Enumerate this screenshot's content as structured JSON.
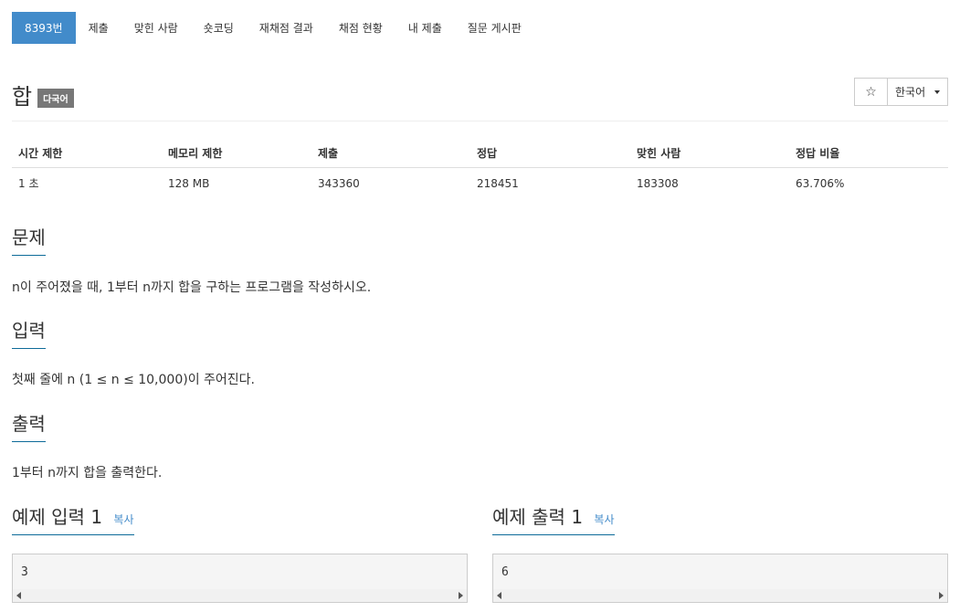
{
  "nav": {
    "tabs": [
      {
        "label": "8393번",
        "active": true
      },
      {
        "label": "제출"
      },
      {
        "label": "맞힌 사람"
      },
      {
        "label": "숏코딩"
      },
      {
        "label": "재채점 결과"
      },
      {
        "label": "채점 현황"
      },
      {
        "label": "내 제출"
      },
      {
        "label": "질문 게시판"
      }
    ]
  },
  "problem": {
    "title": "합",
    "badge": "다국어",
    "star_icon": "☆",
    "language": "한국어"
  },
  "stats": {
    "headers": [
      "시간 제한",
      "메모리 제한",
      "제출",
      "정답",
      "맞힌 사람",
      "정답 비율"
    ],
    "values": [
      "1 초",
      "128 MB",
      "343360",
      "218451",
      "183308",
      "63.706%"
    ]
  },
  "sections": {
    "description": {
      "heading": "문제",
      "text": "n이 주어졌을 때, 1부터 n까지 합을 구하는 프로그램을 작성하시오."
    },
    "input": {
      "heading": "입력",
      "text": "첫째 줄에 n (1 ≤ n ≤ 10,000)이 주어진다."
    },
    "output": {
      "heading": "출력",
      "text": "1부터 n까지 합을 출력한다."
    }
  },
  "samples": {
    "input": {
      "heading": "예제 입력 1",
      "copy": "복사",
      "value": "3"
    },
    "output": {
      "heading": "예제 출력 1",
      "copy": "복사",
      "value": "6"
    }
  },
  "colors": {
    "accent": "#428bca",
    "heading_underline": "#0e6b99",
    "badge": "#777777"
  }
}
